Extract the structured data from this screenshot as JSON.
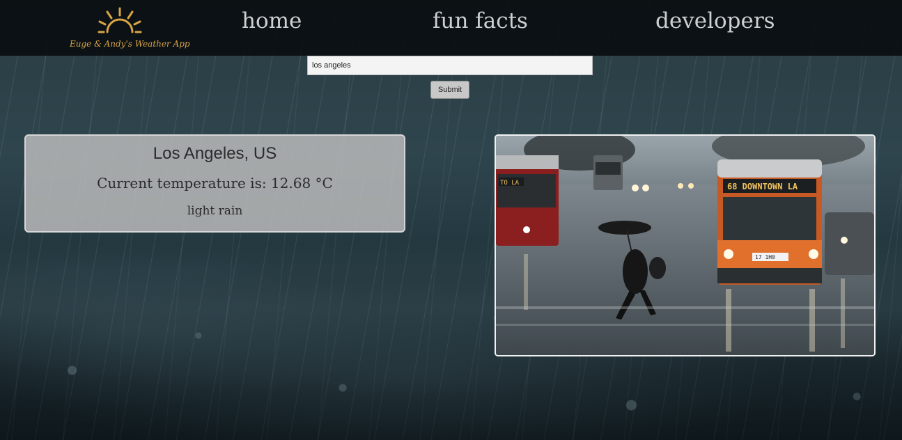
{
  "app": {
    "logo_text": "Euge & Andy's Weather App"
  },
  "nav": {
    "home": "home",
    "fun_facts": "fun facts",
    "developers": "developers"
  },
  "search": {
    "value": "los angeles",
    "submit_label": "Submit"
  },
  "weather": {
    "city": "Los Angeles, US",
    "temperature_text": "Current temperature is: 12.68 °C",
    "description": "light rain"
  },
  "photo": {
    "bus_sign": "68 DOWNTOWN LA",
    "left_bus_sign": "TO LA",
    "plate": "17 1H0"
  },
  "colors": {
    "navbar": "#0a0e11",
    "nav_text": "#cdd0d2",
    "logo_accent": "#d9a646",
    "card_bg": "#bebebe"
  }
}
